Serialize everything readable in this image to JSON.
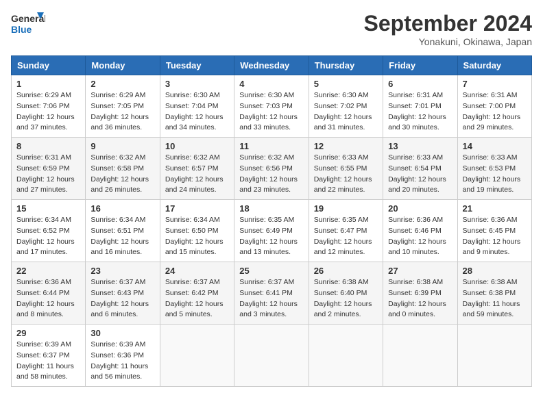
{
  "logo": {
    "line1": "General",
    "line2": "Blue"
  },
  "title": "September 2024",
  "location": "Yonakuni, Okinawa, Japan",
  "days_of_week": [
    "Sunday",
    "Monday",
    "Tuesday",
    "Wednesday",
    "Thursday",
    "Friday",
    "Saturday"
  ],
  "weeks": [
    [
      {
        "day": "1",
        "info": "Sunrise: 6:29 AM\nSunset: 7:06 PM\nDaylight: 12 hours\nand 37 minutes."
      },
      {
        "day": "2",
        "info": "Sunrise: 6:29 AM\nSunset: 7:05 PM\nDaylight: 12 hours\nand 36 minutes."
      },
      {
        "day": "3",
        "info": "Sunrise: 6:30 AM\nSunset: 7:04 PM\nDaylight: 12 hours\nand 34 minutes."
      },
      {
        "day": "4",
        "info": "Sunrise: 6:30 AM\nSunset: 7:03 PM\nDaylight: 12 hours\nand 33 minutes."
      },
      {
        "day": "5",
        "info": "Sunrise: 6:30 AM\nSunset: 7:02 PM\nDaylight: 12 hours\nand 31 minutes."
      },
      {
        "day": "6",
        "info": "Sunrise: 6:31 AM\nSunset: 7:01 PM\nDaylight: 12 hours\nand 30 minutes."
      },
      {
        "day": "7",
        "info": "Sunrise: 6:31 AM\nSunset: 7:00 PM\nDaylight: 12 hours\nand 29 minutes."
      }
    ],
    [
      {
        "day": "8",
        "info": "Sunrise: 6:31 AM\nSunset: 6:59 PM\nDaylight: 12 hours\nand 27 minutes."
      },
      {
        "day": "9",
        "info": "Sunrise: 6:32 AM\nSunset: 6:58 PM\nDaylight: 12 hours\nand 26 minutes."
      },
      {
        "day": "10",
        "info": "Sunrise: 6:32 AM\nSunset: 6:57 PM\nDaylight: 12 hours\nand 24 minutes."
      },
      {
        "day": "11",
        "info": "Sunrise: 6:32 AM\nSunset: 6:56 PM\nDaylight: 12 hours\nand 23 minutes."
      },
      {
        "day": "12",
        "info": "Sunrise: 6:33 AM\nSunset: 6:55 PM\nDaylight: 12 hours\nand 22 minutes."
      },
      {
        "day": "13",
        "info": "Sunrise: 6:33 AM\nSunset: 6:54 PM\nDaylight: 12 hours\nand 20 minutes."
      },
      {
        "day": "14",
        "info": "Sunrise: 6:33 AM\nSunset: 6:53 PM\nDaylight: 12 hours\nand 19 minutes."
      }
    ],
    [
      {
        "day": "15",
        "info": "Sunrise: 6:34 AM\nSunset: 6:52 PM\nDaylight: 12 hours\nand 17 minutes."
      },
      {
        "day": "16",
        "info": "Sunrise: 6:34 AM\nSunset: 6:51 PM\nDaylight: 12 hours\nand 16 minutes."
      },
      {
        "day": "17",
        "info": "Sunrise: 6:34 AM\nSunset: 6:50 PM\nDaylight: 12 hours\nand 15 minutes."
      },
      {
        "day": "18",
        "info": "Sunrise: 6:35 AM\nSunset: 6:49 PM\nDaylight: 12 hours\nand 13 minutes."
      },
      {
        "day": "19",
        "info": "Sunrise: 6:35 AM\nSunset: 6:47 PM\nDaylight: 12 hours\nand 12 minutes."
      },
      {
        "day": "20",
        "info": "Sunrise: 6:36 AM\nSunset: 6:46 PM\nDaylight: 12 hours\nand 10 minutes."
      },
      {
        "day": "21",
        "info": "Sunrise: 6:36 AM\nSunset: 6:45 PM\nDaylight: 12 hours\nand 9 minutes."
      }
    ],
    [
      {
        "day": "22",
        "info": "Sunrise: 6:36 AM\nSunset: 6:44 PM\nDaylight: 12 hours\nand 8 minutes."
      },
      {
        "day": "23",
        "info": "Sunrise: 6:37 AM\nSunset: 6:43 PM\nDaylight: 12 hours\nand 6 minutes."
      },
      {
        "day": "24",
        "info": "Sunrise: 6:37 AM\nSunset: 6:42 PM\nDaylight: 12 hours\nand 5 minutes."
      },
      {
        "day": "25",
        "info": "Sunrise: 6:37 AM\nSunset: 6:41 PM\nDaylight: 12 hours\nand 3 minutes."
      },
      {
        "day": "26",
        "info": "Sunrise: 6:38 AM\nSunset: 6:40 PM\nDaylight: 12 hours\nand 2 minutes."
      },
      {
        "day": "27",
        "info": "Sunrise: 6:38 AM\nSunset: 6:39 PM\nDaylight: 12 hours\nand 0 minutes."
      },
      {
        "day": "28",
        "info": "Sunrise: 6:38 AM\nSunset: 6:38 PM\nDaylight: 11 hours\nand 59 minutes."
      }
    ],
    [
      {
        "day": "29",
        "info": "Sunrise: 6:39 AM\nSunset: 6:37 PM\nDaylight: 11 hours\nand 58 minutes."
      },
      {
        "day": "30",
        "info": "Sunrise: 6:39 AM\nSunset: 6:36 PM\nDaylight: 11 hours\nand 56 minutes."
      },
      {
        "day": "",
        "info": ""
      },
      {
        "day": "",
        "info": ""
      },
      {
        "day": "",
        "info": ""
      },
      {
        "day": "",
        "info": ""
      },
      {
        "day": "",
        "info": ""
      }
    ]
  ]
}
